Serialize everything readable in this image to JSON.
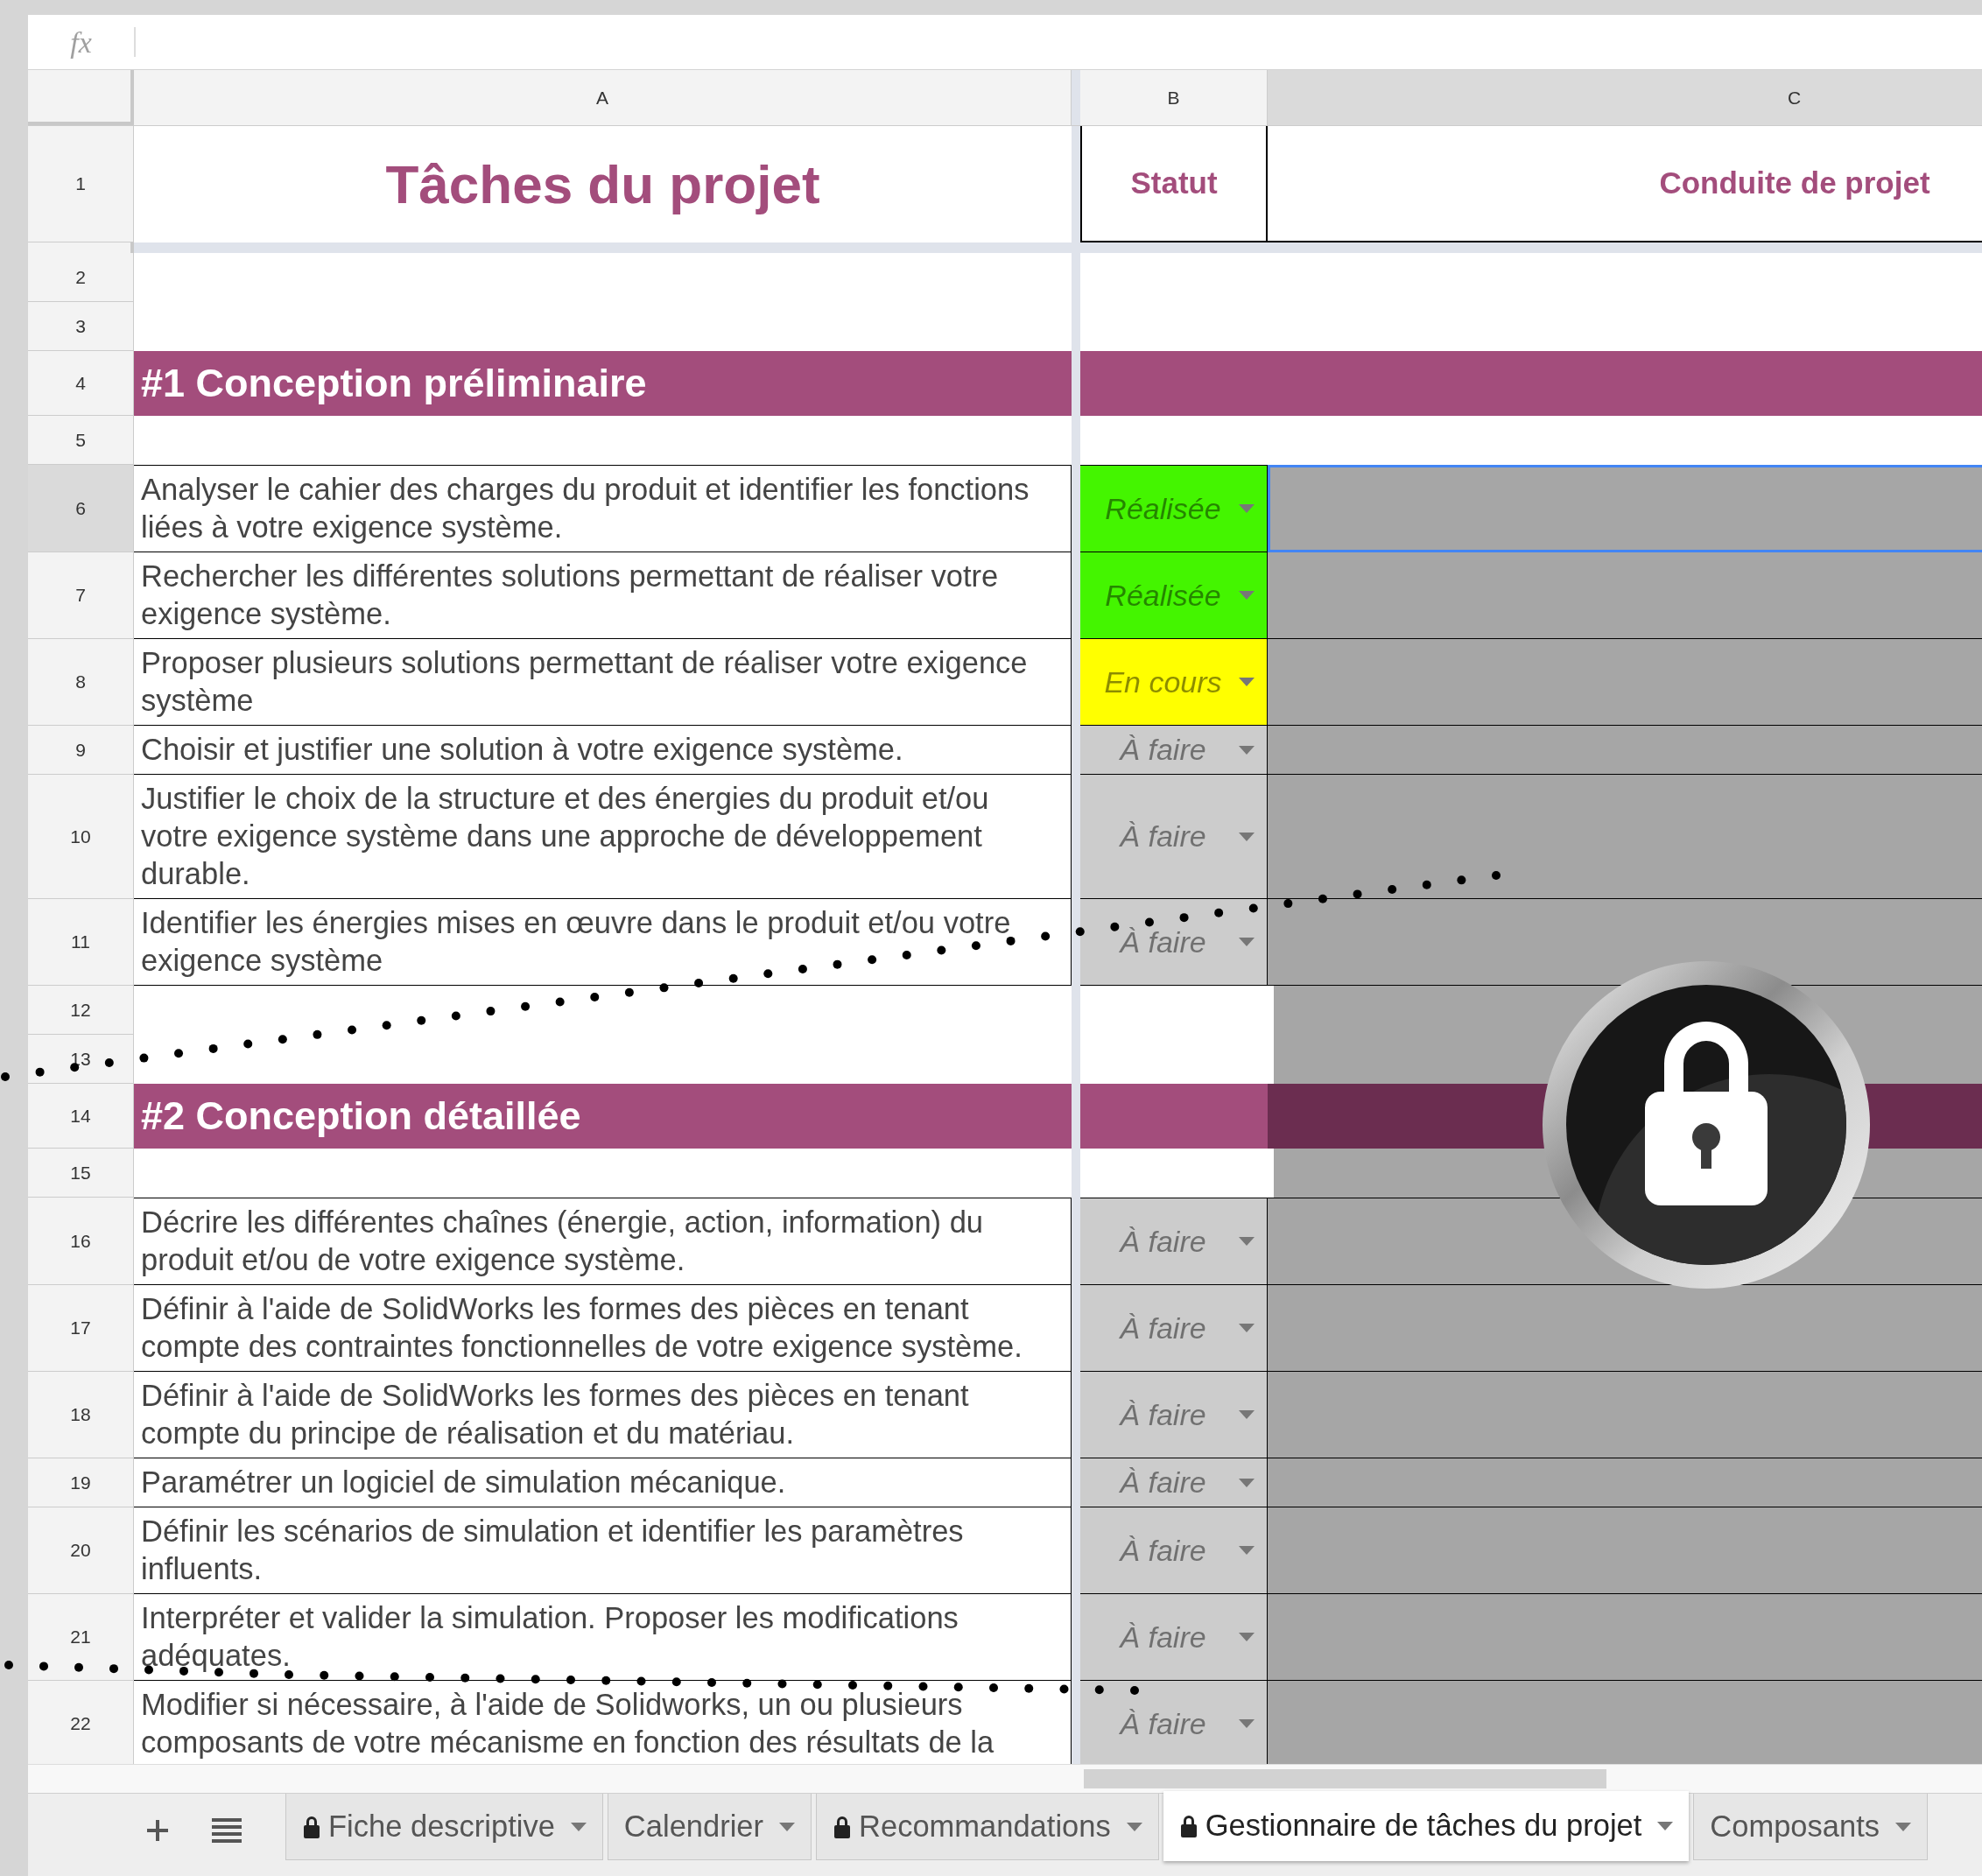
{
  "formula_bar": {
    "label": "fx"
  },
  "columns": [
    {
      "label": "A",
      "selected": false
    },
    {
      "label": "B",
      "selected": false
    },
    {
      "label": "C",
      "selected": true
    }
  ],
  "rows": [
    {
      "number": "1",
      "kind": "header",
      "selected": false,
      "task": "Tâches du projet",
      "status": "Statut",
      "column_c": "Conduite de projet"
    },
    {
      "number": "2",
      "kind": "blank",
      "selected": false,
      "protected": false
    },
    {
      "number": "3",
      "kind": "blank",
      "selected": false,
      "protected": false
    },
    {
      "number": "4",
      "kind": "section",
      "selected": false,
      "protected": false,
      "task": "#1 Conception préliminaire"
    },
    {
      "number": "5",
      "kind": "blank",
      "selected": false,
      "protected": false
    },
    {
      "number": "6",
      "kind": "task",
      "selected": true,
      "protected": true,
      "task": "Analyser le cahier des charges du produit et identifier les fonctions liées à votre exigence système.",
      "status": {
        "label": "Réalisée",
        "color": "#44f500"
      }
    },
    {
      "number": "7",
      "kind": "task",
      "selected": false,
      "protected": true,
      "task": "Rechercher les différentes solutions permettant de réaliser votre exigence système.",
      "status": {
        "label": "Réalisée",
        "color": "#44f500"
      }
    },
    {
      "number": "8",
      "kind": "task",
      "selected": false,
      "protected": true,
      "task": "Proposer plusieurs solutions permettant de réaliser votre exigence système",
      "status": {
        "label": "En cours",
        "color": "#ffff00"
      }
    },
    {
      "number": "9",
      "kind": "task",
      "selected": false,
      "protected": true,
      "task": "Choisir et justifier une solution à votre exigence système.",
      "status": {
        "label": "À faire",
        "color": "#cccccc"
      }
    },
    {
      "number": "10",
      "kind": "task",
      "selected": false,
      "protected": true,
      "task": "Justifier le choix de la structure et des énergies du produit et/ou votre exigence système dans une approche de développement durable.",
      "status": {
        "label": "À faire",
        "color": "#cccccc"
      }
    },
    {
      "number": "11",
      "kind": "task",
      "selected": false,
      "protected": true,
      "task": "Identifier les énergies mises en œuvre dans le produit et/ou votre exigence système",
      "status": {
        "label": "À faire",
        "color": "#cccccc"
      }
    },
    {
      "number": "12",
      "kind": "blank",
      "selected": false,
      "protected": true
    },
    {
      "number": "13",
      "kind": "blank",
      "selected": false,
      "protected": true
    },
    {
      "number": "14",
      "kind": "section",
      "selected": false,
      "protected": true,
      "task": "#2 Conception détaillée"
    },
    {
      "number": "15",
      "kind": "blank",
      "selected": false,
      "protected": true
    },
    {
      "number": "16",
      "kind": "task",
      "selected": false,
      "protected": true,
      "task": "Décrire les différentes chaînes (énergie, action, information) du produit et/ou de votre exigence système.",
      "status": {
        "label": "À faire",
        "color": "#cccccc"
      }
    },
    {
      "number": "17",
      "kind": "task",
      "selected": false,
      "protected": true,
      "task": "Définir à l'aide de SolidWorks les formes des pièces  en tenant compte des contraintes fonctionnelles de votre exigence système.",
      "status": {
        "label": "À faire",
        "color": "#cccccc"
      }
    },
    {
      "number": "18",
      "kind": "task",
      "selected": false,
      "protected": true,
      "task": "Définir à l'aide de SolidWorks les formes des pièces en tenant compte du principe de réalisation et du matériau.",
      "status": {
        "label": "À faire",
        "color": "#cccccc"
      }
    },
    {
      "number": "19",
      "kind": "task",
      "selected": false,
      "protected": true,
      "task": "Paramétrer un logiciel de simulation mécanique.",
      "status": {
        "label": "À faire",
        "color": "#cccccc"
      }
    },
    {
      "number": "20",
      "kind": "task",
      "selected": false,
      "protected": true,
      "task": "Définir les scénarios de simulation et identifier les paramètres influents.",
      "status": {
        "label": "À faire",
        "color": "#cccccc"
      }
    },
    {
      "number": "21",
      "kind": "task",
      "selected": false,
      "protected": true,
      "task": "Interpréter et valider la simulation. Proposer les modifications adéquates.",
      "status": {
        "label": "À faire",
        "color": "#cccccc"
      }
    },
    {
      "number": "22",
      "kind": "task",
      "selected": false,
      "protected": true,
      "task": "Modifier si nécessaire, à l'aide de Solidworks, un ou plusieurs composants de votre mécanisme en fonction des résultats de la",
      "status": {
        "label": "À faire",
        "color": "#cccccc"
      }
    }
  ],
  "sheet_tabs": [
    {
      "label": "Fiche descriptive",
      "locked": true,
      "selected": false
    },
    {
      "label": "Calendrier",
      "locked": false,
      "selected": false
    },
    {
      "label": "Recommandations",
      "locked": true,
      "selected": false
    },
    {
      "label": "Gestionnaire de tâches du projet",
      "locked": true,
      "selected": true
    },
    {
      "label": "Composants",
      "locked": false,
      "selected": false
    }
  ]
}
